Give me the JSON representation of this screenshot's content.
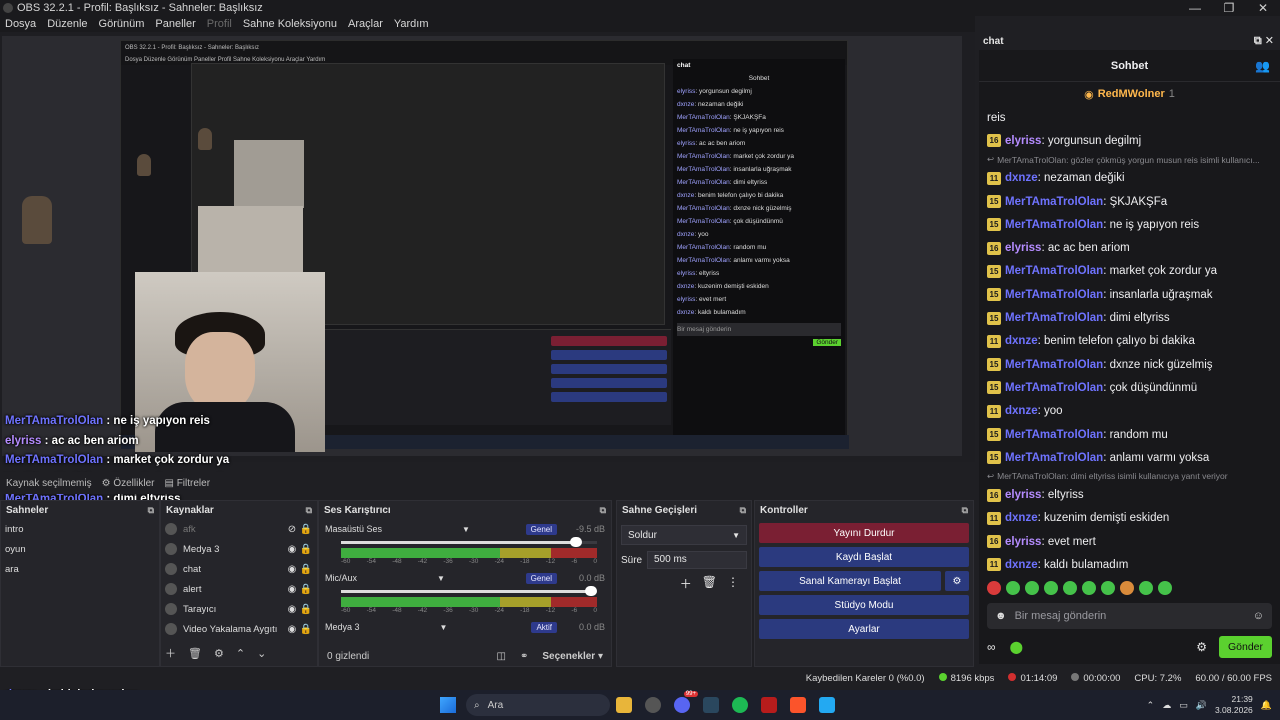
{
  "window": {
    "title": "OBS 32.2.1 - Profil: Başlıksız - Sahneler: Başlıksız",
    "controls": [
      "—",
      "❐",
      "✕"
    ]
  },
  "menu": [
    "Dosya",
    "Düzenle",
    "Görünüm",
    "Paneller",
    "Profil",
    "Sahne Koleksiyonu",
    "Araçlar",
    "Yardım"
  ],
  "nested": {
    "title": "OBS 32.2.1 - Profil: Başlıksız - Sahneler: Başlıksız",
    "menu": "Dosya  Düzenle  Görünüm  Paneller  Profil  Sahne Koleksiyonu  Araçlar  Yardım",
    "chat_title": "chat",
    "chat_header": "Sohbet",
    "chat_lines": [
      {
        "n": "elyriss",
        "t": ": yorgunsun degilmj"
      },
      {
        "n": "dxnze",
        "t": ": nezaman değiki"
      },
      {
        "n": "MerTAmaTrolOlan",
        "t": ": ŞKJAKŞFa"
      },
      {
        "n": "MerTAmaTrolOlan",
        "t": ": ne iş yapıyon reis"
      },
      {
        "n": "elyriss",
        "t": ": ac ac ben ariom"
      },
      {
        "n": "MerTAmaTrolOlan",
        "t": ": market çok zordur ya"
      },
      {
        "n": "MerTAmaTrolOlan",
        "t": ": insanlarla uğraşmak"
      },
      {
        "n": "MerTAmaTrolOlan",
        "t": ": dimi eltyriss"
      },
      {
        "n": "dxnze",
        "t": ": benim telefon çalıyo bi dakika"
      },
      {
        "n": "MerTAmaTrolOlan",
        "t": ": dxnze nick güzelmiş"
      },
      {
        "n": "MerTAmaTrolOlan",
        "t": ": çok düşündünmü"
      },
      {
        "n": "dxnze",
        "t": ": yoo"
      },
      {
        "n": "MerTAmaTrolOlan",
        "t": ": random mu"
      },
      {
        "n": "MerTAmaTrolOlan",
        "t": ": anlamı varmı yoksa"
      },
      {
        "n": "elyriss",
        "t": ": eltyriss"
      },
      {
        "n": "dxnze",
        "t": ": kuzenim demişti eskiden"
      },
      {
        "n": "elyriss",
        "t": ": evet mert"
      },
      {
        "n": "dxnze",
        "t": ": kaldı bulamadım"
      }
    ],
    "input": "Bir mesaj gönderin",
    "send": "Gönder"
  },
  "overlay": [
    {
      "n": "MerTAmaTrolOlan",
      "t": " : ne iş yapıyon reis",
      "c": "blue"
    },
    {
      "n": "elyriss",
      "t": " : ac ac ben ariom",
      "c": "purple"
    },
    {
      "n": "MerTAmaTrolOlan",
      "t": " : market çok zordur ya",
      "c": "blue"
    },
    {
      "n": "MerTAmaTrolOlan",
      "t": " : insanlarla uğraşmak",
      "c": "blue"
    },
    {
      "n": "MerTAmaTrolOlan",
      "t": " : dimi eltyriss",
      "c": "blue"
    },
    {
      "n": "dxnze",
      "t": " : benim telefon çalıyo bi dakika",
      "c": "blue"
    },
    {
      "n": "MerTAmaTrolOlan",
      "t": " : dxnze nick güzelmiş",
      "c": "blue"
    },
    {
      "n": "MerTAmaTrolOlan",
      "t": " : çok düşündünmü",
      "c": "blue"
    },
    {
      "n": "dxnze",
      "t": " : yoo",
      "c": "blue"
    },
    {
      "n": "MerTAmaTrolOlan",
      "t": " : random mu",
      "c": "blue"
    },
    {
      "n": "MerTAmaTrolOlan",
      "t": " : anlamı varmı yoksa",
      "c": "blue"
    },
    {
      "n": "elyriss",
      "t": " : eltyriss",
      "c": "purple"
    },
    {
      "n": "dxnze",
      "t": " : kuzenim demişti eskiden",
      "c": "blue"
    },
    {
      "n": "elyriss",
      "t": " : evet mert",
      "c": "purple"
    },
    {
      "n": "dxnze",
      "t": " : kaldı bulamadım",
      "c": "blue"
    }
  ],
  "below_preview": {
    "no_source": "Kaynak seçilmemiş",
    "properties": "Özellikler",
    "filters": "Filtreler"
  },
  "scenes": {
    "title": "Sahneler",
    "items": [
      "intro",
      "oyun",
      "ara"
    ]
  },
  "sources": {
    "title": "Kaynaklar",
    "items": [
      {
        "label": "afk",
        "visible": false
      },
      {
        "label": "Medya 3",
        "visible": true
      },
      {
        "label": "chat",
        "visible": true
      },
      {
        "label": "alert",
        "visible": true
      },
      {
        "label": "Tarayıcı",
        "visible": true
      },
      {
        "label": "Video Yakalama Aygıtı",
        "visible": true
      }
    ]
  },
  "mixer": {
    "title": "Ses Karıştırıcı",
    "channels": [
      {
        "name": "Masaüstü Ses",
        "tag": "Genel",
        "db": "-9.5 dB",
        "volume": 0.94
      },
      {
        "name": "Mic/Aux",
        "tag": "Genel",
        "db": "0.0 dB",
        "volume": 1.0
      },
      {
        "name": "Medya 3",
        "tag": "Aktif",
        "db": "0.0 dB",
        "volume": 1.0
      }
    ],
    "scale": [
      "-60",
      "-54",
      "-48",
      "-42",
      "-36",
      "-30",
      "-24",
      "-18",
      "-12",
      "-6",
      "0"
    ],
    "hidden": "0 gizlendi",
    "options": "Seçenekler"
  },
  "transitions": {
    "title": "Sahne Geçişleri",
    "type": "Soldur",
    "duration_label": "Süre",
    "duration": "500 ms"
  },
  "controls": {
    "title": "Kontroller",
    "buttons": [
      "Yayını Durdur",
      "Kaydı Başlat",
      "Sanal Kamerayı Başlat",
      "Stüdyo Modu",
      "Ayarlar"
    ]
  },
  "chat": {
    "title": "chat",
    "header": "Sohbet",
    "pinned_user": "RedMWolner",
    "pinned_count": "1",
    "first_line": "reis",
    "messages": [
      {
        "badge": "16",
        "n": "elyriss",
        "t": ": yorgunsun degilmj",
        "c": "#b58cff"
      },
      {
        "reply": "MerTAmaTrolOlan: gözler çökmüş yorgun musun reis isimli kullanıcı..."
      },
      {
        "badge": "11",
        "n": "dxnze",
        "t": ": nezaman değiki",
        "c": "#6f73ff"
      },
      {
        "badge": "15",
        "n": "MerTAmaTrolOlan",
        "t": ": ŞKJAKŞFa",
        "c": "#6f73ff"
      },
      {
        "badge": "15",
        "n": "MerTAmaTrolOlan",
        "t": ": ne iş yapıyon reis",
        "c": "#6f73ff"
      },
      {
        "badge": "16",
        "n": "elyriss",
        "t": ": ac ac ben ariom",
        "c": "#b58cff"
      },
      {
        "badge": "15",
        "n": "MerTAmaTrolOlan",
        "t": ": market çok zordur ya",
        "c": "#6f73ff"
      },
      {
        "badge": "15",
        "n": "MerTAmaTrolOlan",
        "t": ": insanlarla uğraşmak",
        "c": "#6f73ff"
      },
      {
        "badge": "15",
        "n": "MerTAmaTrolOlan",
        "t": ": dimi eltyriss",
        "c": "#6f73ff"
      },
      {
        "badge": "11",
        "n": "dxnze",
        "t": ": benim telefon çalıyo bi dakika",
        "c": "#6f73ff"
      },
      {
        "badge": "15",
        "n": "MerTAmaTrolOlan",
        "t": ": dxnze nick güzelmiş",
        "c": "#6f73ff"
      },
      {
        "badge": "15",
        "n": "MerTAmaTrolOlan",
        "t": ": çok düşündünmü",
        "c": "#6f73ff"
      },
      {
        "badge": "11",
        "n": "dxnze",
        "t": ": yoo",
        "c": "#6f73ff"
      },
      {
        "badge": "15",
        "n": "MerTAmaTrolOlan",
        "t": ": random mu",
        "c": "#6f73ff"
      },
      {
        "badge": "15",
        "n": "MerTAmaTrolOlan",
        "t": ": anlamı varmı yoksa",
        "c": "#6f73ff"
      },
      {
        "reply": "MerTAmaTrolOlan: dimi eltyriss isimli kullanıcıya yanıt veriyor"
      },
      {
        "badge": "16",
        "n": "elyriss",
        "t": ": eltyriss",
        "c": "#b58cff"
      },
      {
        "badge": "11",
        "n": "dxnze",
        "t": ": kuzenim demişti eskiden",
        "c": "#6f73ff"
      },
      {
        "badge": "16",
        "n": "elyriss",
        "t": ": evet mert",
        "c": "#b58cff"
      },
      {
        "badge": "11",
        "n": "dxnze",
        "t": ": kaldı bulamadım",
        "c": "#6f73ff"
      }
    ],
    "input_placeholder": "Bir mesaj gönderin",
    "send": "Gönder"
  },
  "status": {
    "dropped": "Kaybedilen Kareler 0 (%0.0)",
    "bitrate": "8196 kbps",
    "stream_time": "01:14:09",
    "rec_time": "00:00:00",
    "cpu": "CPU: 7.2%",
    "fps": "60.00 / 60.00 FPS"
  },
  "taskbar": {
    "search": "Ara",
    "time": "21:39",
    "date": "3.08.2026",
    "badge": "99+"
  },
  "colors": {
    "accent_blue": "#2b3a7f",
    "stop_red": "#7a1f33",
    "send_green": "#5bd12f",
    "name_blue": "#6f73ff",
    "name_purple": "#b58cff"
  }
}
